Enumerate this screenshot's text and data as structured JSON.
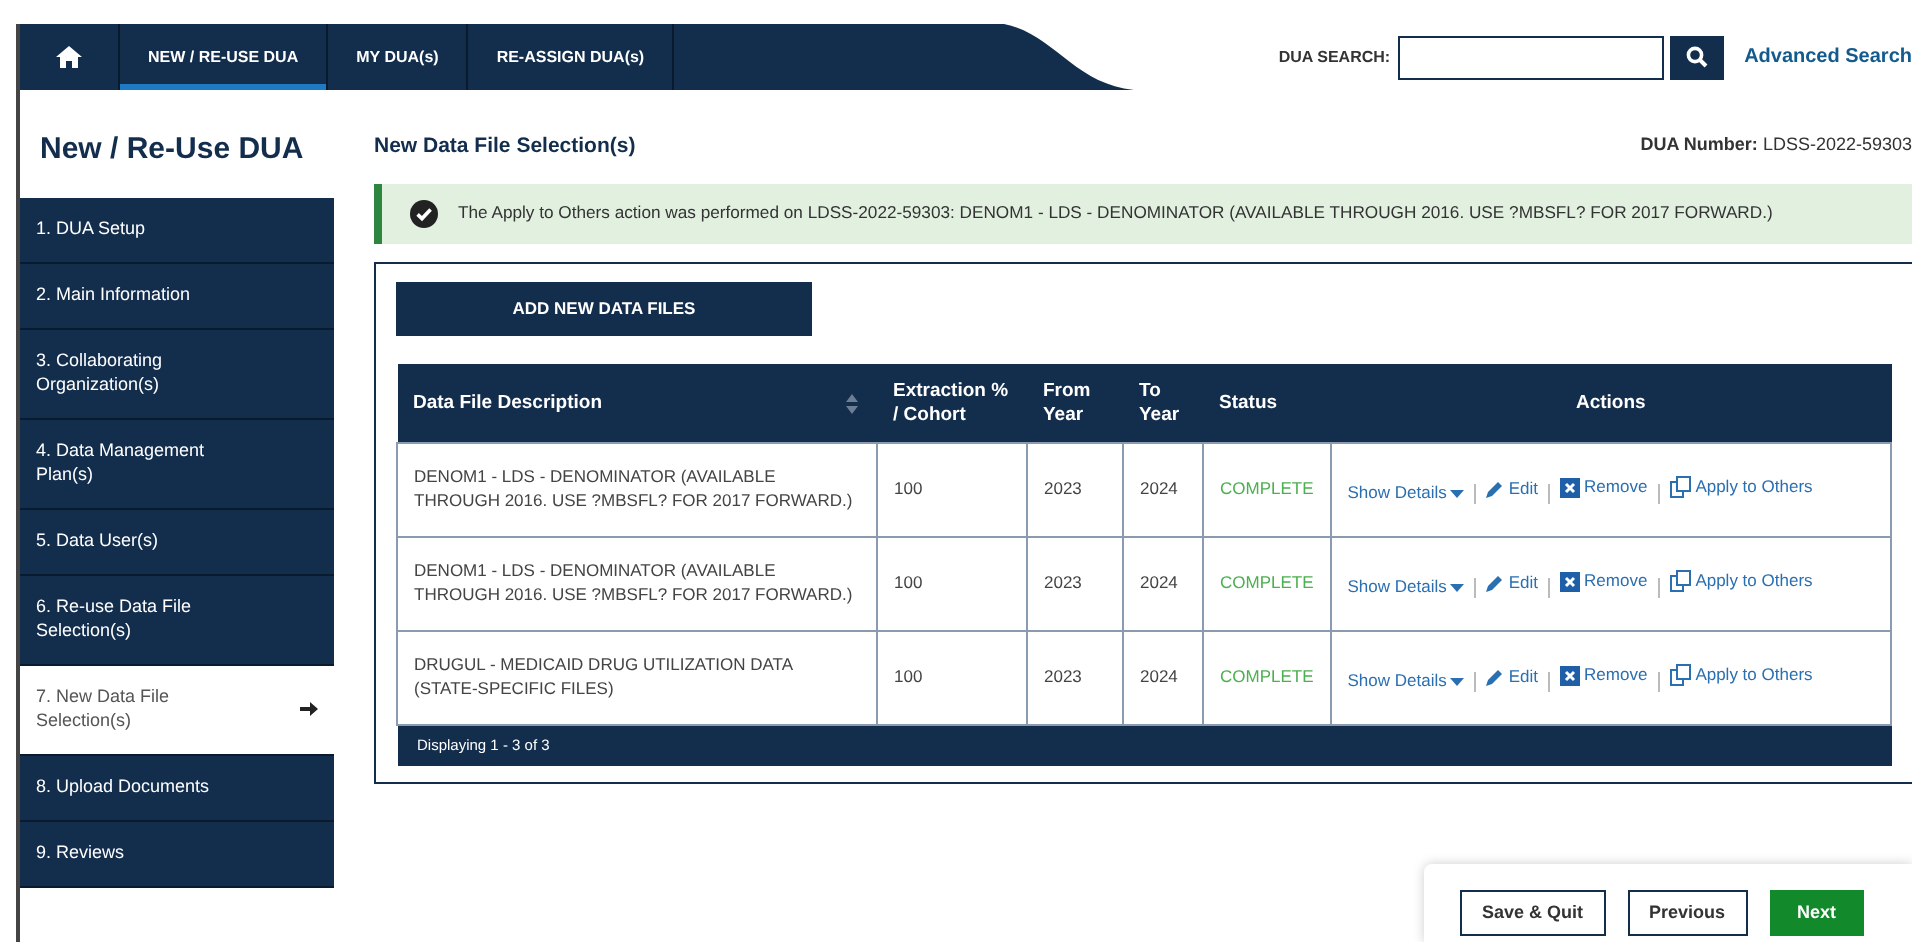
{
  "nav": {
    "tabs": [
      {
        "kind": "home",
        "selected": false
      },
      {
        "kind": "text",
        "label": "NEW / RE-USE DUA",
        "selected": true
      },
      {
        "kind": "text",
        "label": "MY DUA(s)",
        "selected": false
      },
      {
        "kind": "text",
        "label": "RE-ASSIGN DUA(s)",
        "selected": false
      }
    ],
    "search_label": "DUA SEARCH:",
    "advanced_search": "Advanced Search"
  },
  "sidebar": {
    "title": "New / Re-Use DUA",
    "items": [
      {
        "label": "1. DUA Setup",
        "selected": false
      },
      {
        "label": "2. Main Information",
        "selected": false
      },
      {
        "label": "3. Collaborating Organization(s)",
        "selected": false
      },
      {
        "label": "4. Data Management Plan(s)",
        "selected": false
      },
      {
        "label": "5. Data User(s)",
        "selected": false
      },
      {
        "label": "6. Re-use Data File Selection(s)",
        "selected": false
      },
      {
        "label": "7. New Data File Selection(s)",
        "selected": true
      },
      {
        "label": "8. Upload Documents",
        "selected": false
      },
      {
        "label": "9. Reviews",
        "selected": false
      }
    ]
  },
  "main": {
    "heading": "New Data File Selection(s)",
    "dua_number_label": "DUA Number:",
    "dua_number": "LDSS-2022-59303",
    "alert": {
      "kind": "success",
      "text": "The Apply to Others action was performed on LDSS-2022-59303: DENOM1 - LDS - DENOMINATOR (AVAILABLE THROUGH 2016. USE ?MBSFL? FOR 2017 FORWARD.)"
    },
    "add_button": "ADD NEW DATA FILES",
    "table": {
      "columns": [
        "Data File Description",
        "Extraction % / Cohort",
        "From Year",
        "To Year",
        "Status",
        "Actions"
      ],
      "rows": [
        {
          "description": "DENOM1 - LDS - DENOMINATOR (AVAILABLE THROUGH 2016. USE ?MBSFL? FOR 2017 FORWARD.)",
          "extraction": "100",
          "from_year": "2023",
          "to_year": "2024",
          "status": "COMPLETE",
          "actions": [
            {
              "kind": "details",
              "label": "Show Details"
            },
            {
              "kind": "edit",
              "label": "Edit"
            },
            {
              "kind": "remove",
              "label": "Remove"
            },
            {
              "kind": "apply",
              "label": "Apply to Others"
            }
          ]
        },
        {
          "description": "DENOM1 - LDS - DENOMINATOR (AVAILABLE THROUGH 2016. USE ?MBSFL? FOR 2017 FORWARD.)",
          "extraction": "100",
          "from_year": "2023",
          "to_year": "2024",
          "status": "COMPLETE",
          "actions": [
            {
              "kind": "details",
              "label": "Show Details"
            },
            {
              "kind": "edit",
              "label": "Edit"
            },
            {
              "kind": "remove",
              "label": "Remove"
            },
            {
              "kind": "apply",
              "label": "Apply to Others"
            }
          ]
        },
        {
          "description": "DRUGUL - MEDICAID DRUG UTILIZATION DATA (STATE-SPECIFIC FILES)",
          "extraction": "100",
          "from_year": "2023",
          "to_year": "2024",
          "status": "COMPLETE",
          "actions": [
            {
              "kind": "details",
              "label": "Show Details"
            },
            {
              "kind": "edit",
              "label": "Edit"
            },
            {
              "kind": "remove",
              "label": "Remove"
            },
            {
              "kind": "apply",
              "label": "Apply to Others"
            }
          ]
        }
      ],
      "footer": "Displaying 1 - 3 of 3"
    }
  },
  "footer_buttons": [
    {
      "kind": "outline",
      "label": "Save & Quit"
    },
    {
      "kind": "outline",
      "label": "Previous"
    },
    {
      "kind": "primary",
      "label": "Next"
    }
  ]
}
